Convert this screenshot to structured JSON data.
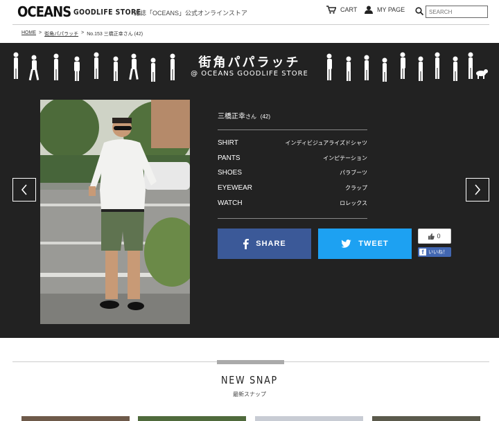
{
  "header": {
    "logo": "OCEANS",
    "store": "GOODLIFE STORE",
    "tagline": "雑誌「OCEANS」公式オンラインストア",
    "cart_label": "CART",
    "mypage_label": "MY PAGE",
    "search_placeholder": "SEARCH"
  },
  "breadcrumb": {
    "home": "HOME",
    "sep1": ">",
    "section": "街角パパラッチ",
    "sep2": ">",
    "current": "No.153 三橋正幸さん (42)"
  },
  "hero": {
    "title": "街角パパラッチ",
    "subtitle": "@ OCEANS GOODLIFE STORE"
  },
  "profile": {
    "name": "三橋正幸",
    "honorific": "さん",
    "age": "(42)",
    "specs": [
      {
        "key": "SHIRT",
        "value": "インディビジュアライズドシャツ"
      },
      {
        "key": "PANTS",
        "value": "インピテーション"
      },
      {
        "key": "SHOES",
        "value": "パラブーツ"
      },
      {
        "key": "EYEWEAR",
        "value": "クラップ"
      },
      {
        "key": "WATCH",
        "value": "ロレックス"
      }
    ]
  },
  "share": {
    "share_label": "SHARE",
    "tweet_label": "TWEET",
    "like_count": "0",
    "like_label": "いいね！"
  },
  "snap": {
    "title": "NEW SNAP",
    "subtitle": "最新スナップ"
  },
  "colors": {
    "hero_bg": "#222222",
    "facebook": "#3b5998",
    "twitter": "#1da1f2"
  }
}
